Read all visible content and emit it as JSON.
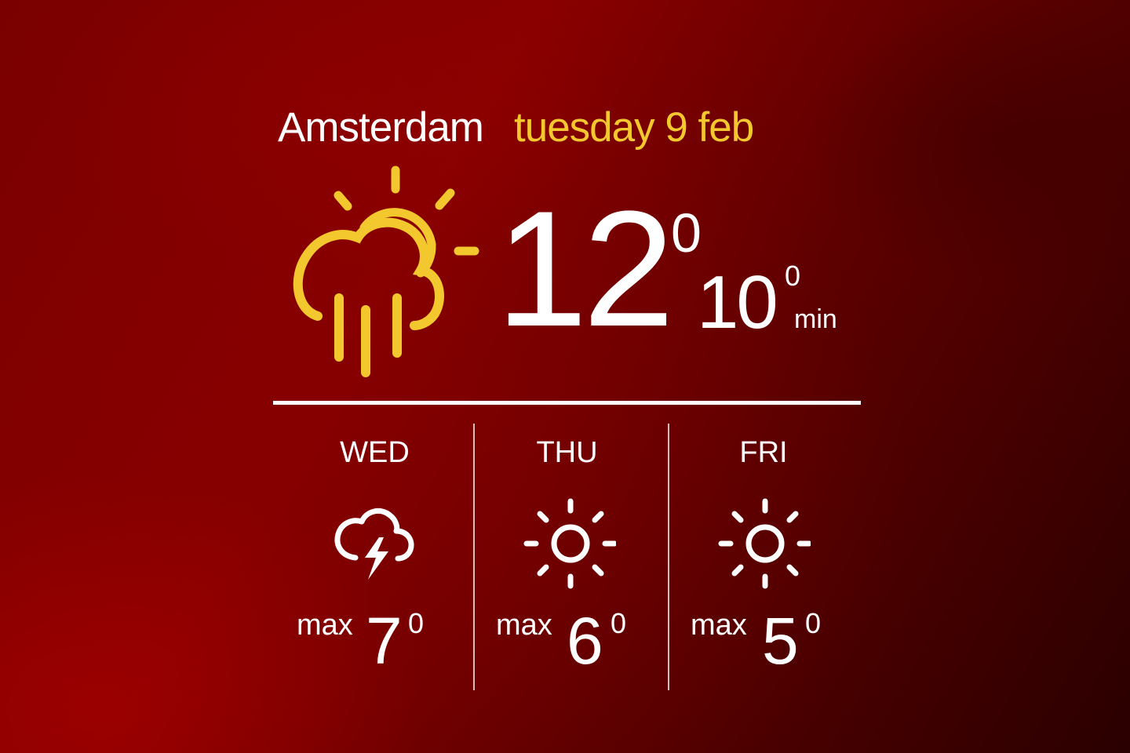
{
  "location": {
    "city": "Amsterdam",
    "date": "tuesday 9 feb"
  },
  "current": {
    "icon": "sun-cloud-rain-icon",
    "temp": "12",
    "temp_unit": "0",
    "min_temp": "10",
    "min_unit": "0",
    "min_label": "min"
  },
  "forecast": [
    {
      "day": "WED",
      "icon": "thunderstorm-icon",
      "max_label": "max",
      "max": "7",
      "unit": "0"
    },
    {
      "day": "THU",
      "icon": "sun-icon",
      "max_label": "max",
      "max": "6",
      "unit": "0"
    },
    {
      "day": "FRI",
      "icon": "sun-icon",
      "max_label": "max",
      "max": "5",
      "unit": "0"
    }
  ],
  "colors": {
    "accent": "#f3c82e",
    "text": "#ffffff",
    "background": "#7a0000"
  }
}
